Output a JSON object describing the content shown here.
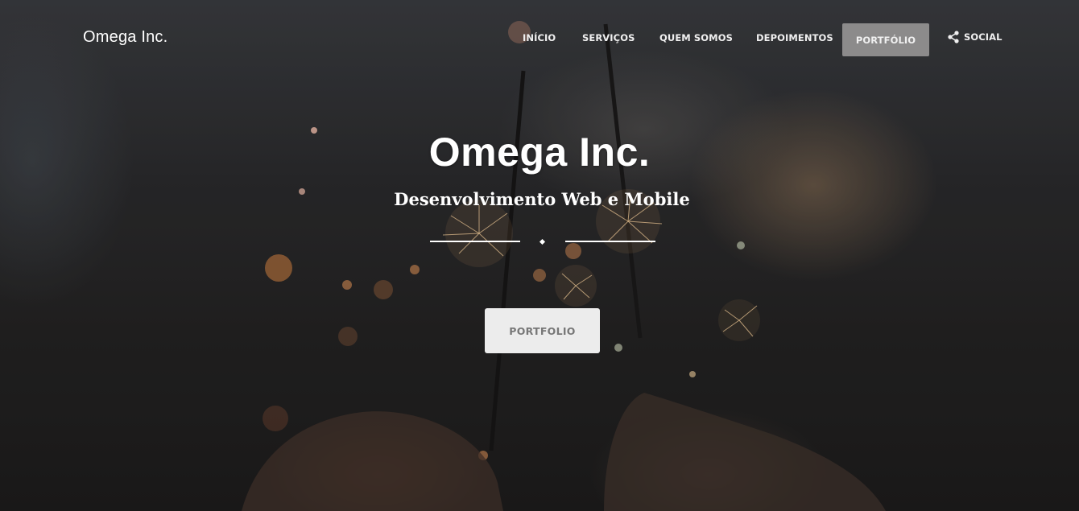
{
  "header": {
    "brand": "Omega Inc.",
    "nav": [
      {
        "label": "INÍCIO"
      },
      {
        "label": "SERVIÇOS"
      },
      {
        "label": "QUEM SOMOS"
      },
      {
        "label": "DEPOIMENTOS"
      },
      {
        "label": "PORTFÓLIO",
        "active": true
      },
      {
        "label": "SOCIAL",
        "icon": "share-icon"
      }
    ]
  },
  "hero": {
    "title": "Omega Inc.",
    "subtitle": "Desenvolvimento Web e Mobile",
    "cta_label": "PORTFOLIO",
    "background": "sparklers-photo"
  },
  "colors": {
    "active_nav_bg": "#8c8b8b",
    "cta_bg": "#ececec",
    "cta_text": "#777777"
  }
}
